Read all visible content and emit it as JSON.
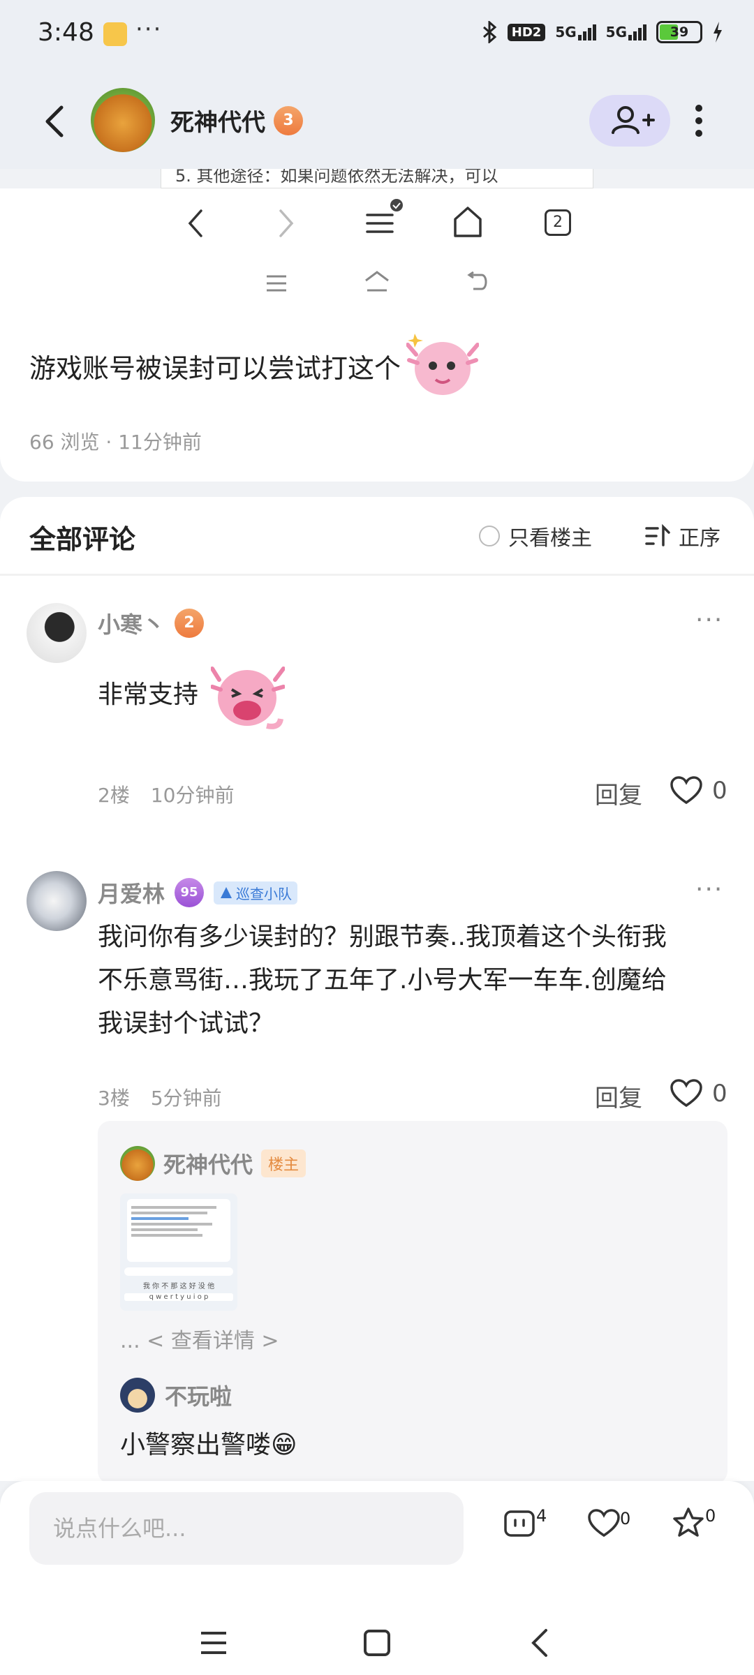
{
  "status_bar": {
    "time": "3:48",
    "more": "···",
    "hd": "HD2",
    "net1": "5G",
    "net2": "5G",
    "battery": "39"
  },
  "header": {
    "host_name": "死神代代",
    "host_level": "3"
  },
  "overlay": {
    "snippet": "5. 其他途径：如果问题依然无法解决，可以"
  },
  "browser_nav": {
    "tab_count": "2"
  },
  "post": {
    "title": "游戏账号被误封可以尝试打这个",
    "views": "66 浏览",
    "time": "11分钟前"
  },
  "comments_header": {
    "title": "全部评论",
    "only_host": "只看楼主",
    "sort": "正序"
  },
  "comments": [
    {
      "user": "小寒丶",
      "level": "2",
      "text": "非常支持",
      "floor": "2楼",
      "time": "10分钟前",
      "reply": "回复",
      "likes": "0"
    },
    {
      "user": "月爱林",
      "level": "95",
      "badge": "巡查小队",
      "text_lines": [
        "我问你有多少误封的？别跟节奏..我顶着这个头衔我",
        "不乐意骂街…我玩了五年了.小号大军一车车.创魔给",
        "我误封个试试？"
      ],
      "floor": "3楼",
      "time": "5分钟前",
      "reply": "回复",
      "likes": "0"
    }
  ],
  "sub_replies": {
    "host_name": "死神代代",
    "host_tag": "楼主",
    "view_detail": "... < 查看详情 >",
    "thumb_keys": "q w e r t y u i o p",
    "thumb_chips": "我 你 不 那 这 好 没 他",
    "second_user": "不玩啦",
    "second_text": "小警察出警喽😁"
  },
  "bottom_bar": {
    "placeholder": "说点什么吧...",
    "comment_count": "4",
    "like_count": "0",
    "star_count": "0"
  },
  "colors": {
    "accent": "#6b63e0",
    "follow_bg": "#dcdaf7",
    "host_tag": "#e48a3f",
    "patrol": "#3a7ad6"
  }
}
